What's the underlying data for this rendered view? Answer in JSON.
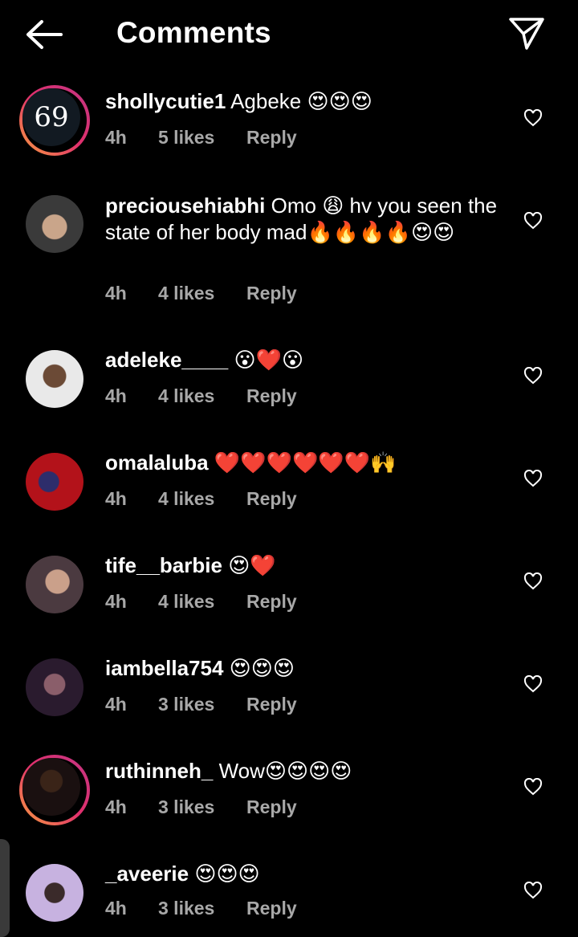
{
  "header": {
    "title": "Comments"
  },
  "comments": [
    {
      "user": "shollycutie1",
      "text": "Agbeke 😍😍😍",
      "time": "4h",
      "likes": "5 likes",
      "reply": "Reply",
      "avatar_label": "69",
      "avatar_colors": [
        "#121a22"
      ]
    },
    {
      "user": "preciousehiabhi",
      "text": "Omo 😩 hv you seen the state of her body mad🔥🔥🔥🔥😍😍",
      "time": "4h",
      "likes": "4 likes",
      "reply": "Reply",
      "avatar_colors": [
        "#3a3a3a",
        "#c9a58a"
      ]
    },
    {
      "user": "adeleke____",
      "text": "😮❤️😮",
      "time": "4h",
      "likes": "4 likes",
      "reply": "Reply",
      "avatar_colors": [
        "#e9e9e9",
        "#6b4a36"
      ]
    },
    {
      "user": "omalaluba",
      "text": "❤️❤️❤️❤️❤️❤️🙌",
      "time": "4h",
      "likes": "4 likes",
      "reply": "Reply",
      "avatar_colors": [
        "#b3121a",
        "#2d2d6b"
      ]
    },
    {
      "user": "tife__barbie",
      "text": "😍❤️",
      "time": "4h",
      "likes": "4 likes",
      "reply": "Reply",
      "avatar_colors": [
        "#4b3a40",
        "#caa08a"
      ]
    },
    {
      "user": "iambella754",
      "text": "😍😍😍",
      "time": "4h",
      "likes": "3 likes",
      "reply": "Reply",
      "avatar_colors": [
        "#2a1b2e",
        "#8a5e6a"
      ]
    },
    {
      "user": "ruthinneh_",
      "text": "Wow😍😍😍😍",
      "time": "4h",
      "likes": "3 likes",
      "reply": "Reply",
      "avatar_colors": [
        "#3a2418",
        "#1a1010"
      ]
    },
    {
      "user": "_aveerie",
      "text": "😍😍😍",
      "time": "4h",
      "likes": "3 likes",
      "reply": "Reply",
      "avatar_colors": [
        "#c7b2e0",
        "#3a2a2a"
      ]
    }
  ]
}
